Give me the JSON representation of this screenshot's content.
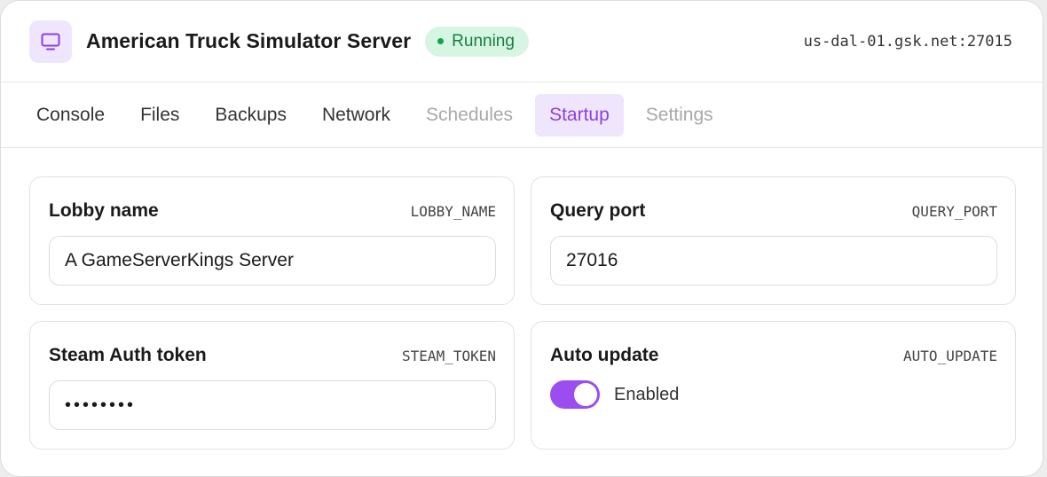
{
  "server": {
    "title": "American Truck Simulator Server",
    "status": "Running",
    "address": "us-dal-01.gsk.net:27015",
    "icon": "monitor-icon"
  },
  "tabs": [
    {
      "label": "Console",
      "state": "normal"
    },
    {
      "label": "Files",
      "state": "normal"
    },
    {
      "label": "Backups",
      "state": "normal"
    },
    {
      "label": "Network",
      "state": "normal"
    },
    {
      "label": "Schedules",
      "state": "disabled"
    },
    {
      "label": "Startup",
      "state": "active"
    },
    {
      "label": "Settings",
      "state": "disabled"
    }
  ],
  "fields": {
    "lobby_name": {
      "label": "Lobby name",
      "key": "LOBBY_NAME",
      "value": "A GameServerKings Server"
    },
    "query_port": {
      "label": "Query port",
      "key": "QUERY_PORT",
      "value": "27016"
    },
    "steam_token": {
      "label": "Steam Auth token",
      "key": "STEAM_TOKEN",
      "value": "••••••••"
    },
    "auto_update": {
      "label": "Auto update",
      "key": "AUTO_UPDATE",
      "state_label": "Enabled",
      "enabled": true
    }
  },
  "colors": {
    "accent": "#8b3fe6",
    "toggle_on": "#9b4df0",
    "status_bg": "#d7f5e3",
    "status_text": "#15803d"
  }
}
